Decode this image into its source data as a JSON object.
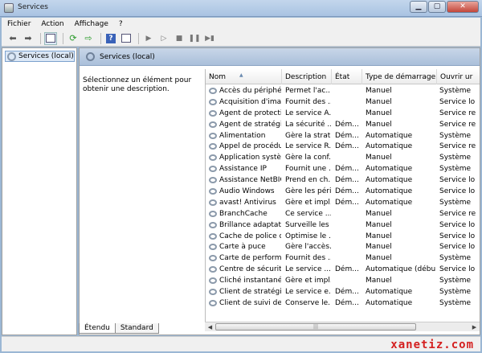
{
  "window": {
    "title": "Services",
    "min_label": "▁",
    "max_label": "▢",
    "close_label": "✕"
  },
  "menu": [
    "Fichier",
    "Action",
    "Affichage",
    "?"
  ],
  "tree": {
    "root_label": "Services (local)"
  },
  "panel": {
    "header": "Services (local)",
    "description_hint": "Sélectionnez un élément pour obtenir une description."
  },
  "table": {
    "columns": [
      "Nom",
      "Description",
      "État",
      "Type de démarrage",
      "Ouvrir ur"
    ],
    "rows": [
      [
        "Accès du périphér...",
        "Permet l'ac...",
        "",
        "Manuel",
        "Système"
      ],
      [
        "Acquisition d'ima...",
        "Fournit des ...",
        "",
        "Manuel",
        "Service lo"
      ],
      [
        "Agent de protecti...",
        "Le service A...",
        "",
        "Manuel",
        "Service re"
      ],
      [
        "Agent de stratégie...",
        "La sécurité ...",
        "Dém...",
        "Manuel",
        "Service re"
      ],
      [
        "Alimentation",
        "Gère la strat...",
        "Dém...",
        "Automatique",
        "Système"
      ],
      [
        "Appel de procédu...",
        "Le service R...",
        "Dém...",
        "Automatique",
        "Service re"
      ],
      [
        "Application systè...",
        "Gère la conf...",
        "",
        "Manuel",
        "Système"
      ],
      [
        "Assistance IP",
        "Fournit une ...",
        "Dém...",
        "Automatique",
        "Système"
      ],
      [
        "Assistance NetBIO...",
        "Prend en ch...",
        "Dém...",
        "Automatique",
        "Service lo"
      ],
      [
        "Audio Windows",
        "Gère les péri...",
        "Dém...",
        "Automatique",
        "Service lo"
      ],
      [
        "avast! Antivirus",
        "Gère et impl...",
        "Dém...",
        "Automatique",
        "Système"
      ],
      [
        "BranchCache",
        "Ce service ...",
        "",
        "Manuel",
        "Service re"
      ],
      [
        "Brillance adaptative",
        "Surveille les ...",
        "",
        "Manuel",
        "Service lo"
      ],
      [
        "Cache de police d...",
        "Optimise le ...",
        "",
        "Manuel",
        "Service lo"
      ],
      [
        "Carte à puce",
        "Gère l'accès...",
        "",
        "Manuel",
        "Service lo"
      ],
      [
        "Carte de performa...",
        "Fournit des ...",
        "",
        "Manuel",
        "Système"
      ],
      [
        "Centre de sécurité",
        "Le service ...",
        "Dém...",
        "Automatique (débu...",
        "Service lo"
      ],
      [
        "Cliché instantané ...",
        "Gère et impl...",
        "",
        "Manuel",
        "Système"
      ],
      [
        "Client de stratégie...",
        "Le service e...",
        "Dém...",
        "Automatique",
        "Système"
      ],
      [
        "Client de suivi de l...",
        "Conserve le...",
        "Dém...",
        "Automatique",
        "Système"
      ]
    ]
  },
  "tabs": [
    "Étendu",
    "Standard"
  ],
  "watermark": "xanetiz.com"
}
